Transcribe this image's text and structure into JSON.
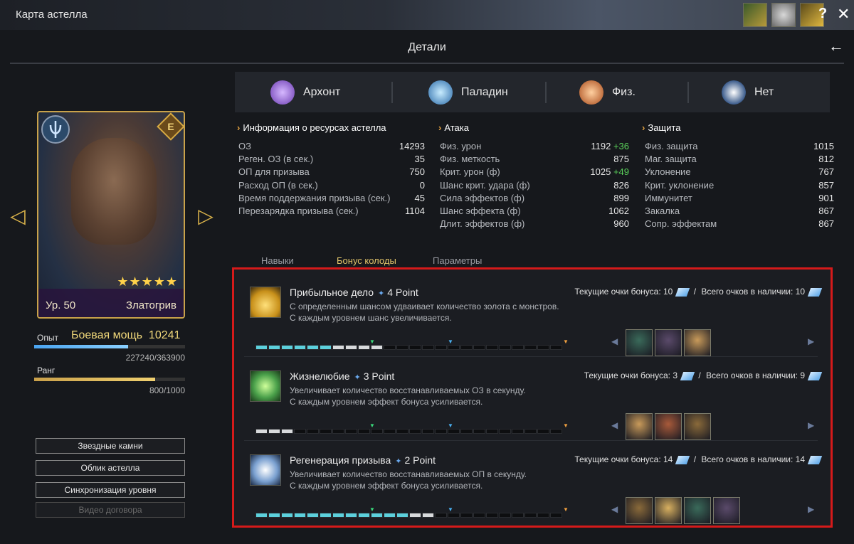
{
  "window": {
    "title": "Карта астелла",
    "help": "?",
    "close": "✕"
  },
  "header": {
    "title": "Детали",
    "back": "←"
  },
  "card": {
    "rank_badge": "E",
    "stars": "★★★★★",
    "level": "Ур. 50",
    "name": "Златогрив"
  },
  "progress": {
    "exp_label": "Опыт",
    "power_label": "Боевая мощь",
    "power_value": "10241",
    "exp_text": "227240/363900",
    "exp_fraction": 0.624,
    "rank_label": "Ранг",
    "rank_text": "800/1000",
    "rank_fraction": 0.8
  },
  "side_buttons": [
    {
      "label": "Звездные камни",
      "enabled": true
    },
    {
      "label": "Облик астелла",
      "enabled": true
    },
    {
      "label": "Синхронизация уровня",
      "enabled": true
    },
    {
      "label": "Видео договора",
      "enabled": false
    }
  ],
  "tags": [
    {
      "label": "Архонт",
      "icon": "archon-icon",
      "color": "#a07ad0"
    },
    {
      "label": "Паладин",
      "icon": "paladin-icon",
      "color": "#4aa4d8"
    },
    {
      "label": "Физ.",
      "icon": "physical-icon",
      "color": "#d87a3a"
    },
    {
      "label": "Нет",
      "icon": "element-none-icon",
      "color": "#8ab0e0"
    }
  ],
  "stats": {
    "resources": {
      "title": "Информация о ресурсах астелла",
      "rows": [
        {
          "label": "ОЗ",
          "value": "14293"
        },
        {
          "label": "Реген. ОЗ (в сек.)",
          "value": "35"
        },
        {
          "label": "ОП для призыва",
          "value": "750"
        },
        {
          "label": "Расход ОП (в сек.)",
          "value": "0"
        },
        {
          "label": "Время поддержания призыва (сек.)",
          "value": "45"
        },
        {
          "label": "Перезарядка призыва (сек.)",
          "value": "1104"
        }
      ]
    },
    "attack": {
      "title": "Атака",
      "rows": [
        {
          "label": "Физ. урон",
          "value": "1192",
          "bonus": "+36"
        },
        {
          "label": "Физ. меткость",
          "value": "875",
          "bonus": ""
        },
        {
          "label": "Крит. урон (ф)",
          "value": "1025",
          "bonus": "+49"
        },
        {
          "label": "Шанс крит. удара (ф)",
          "value": "826",
          "bonus": ""
        },
        {
          "label": "Сила эффектов (ф)",
          "value": "899",
          "bonus": ""
        },
        {
          "label": "Шанс эффекта (ф)",
          "value": "1062",
          "bonus": ""
        },
        {
          "label": "Длит. эффектов (ф)",
          "value": "960",
          "bonus": ""
        }
      ]
    },
    "defense": {
      "title": "Защита",
      "rows": [
        {
          "label": "Физ. защита",
          "value": "1015"
        },
        {
          "label": "Маг. защита",
          "value": "812"
        },
        {
          "label": "Уклонение",
          "value": "767"
        },
        {
          "label": "Крит. уклонение",
          "value": "857"
        },
        {
          "label": "Иммунитет",
          "value": "901"
        },
        {
          "label": "Закалка",
          "value": "867"
        },
        {
          "label": "Сопр. эффектам",
          "value": "867"
        }
      ]
    }
  },
  "tabs": [
    {
      "label": "Навыки",
      "active": false
    },
    {
      "label": "Бонус колоды",
      "active": true
    },
    {
      "label": "Параметры",
      "active": false
    }
  ],
  "bonuses": [
    {
      "name": "Прибыльное дело",
      "points": "4 Point",
      "desc1": "С определенным шансом удваивает количество золота с монстров.",
      "desc2": "С каждым уровнем шанс увеличивается.",
      "current": "Текущие очки бонуса: 10",
      "sep": "/",
      "total": "Всего очков в наличии: 10",
      "icon": "gold-bars-icon",
      "filled": 6,
      "partial": 4,
      "heroes": 3
    },
    {
      "name": "Жизнелюбие",
      "points": "3 Point",
      "desc1": "Увеличивает количество восстанавливаемых ОЗ в секунду.",
      "desc2": "С каждым уровнем эффект бонуса усиливается.",
      "current": "Текущие очки бонуса: 3",
      "sep": "/",
      "total": "Всего очков в наличии: 9",
      "icon": "green-cross-icon",
      "filled": 0,
      "partial": 3,
      "heroes": 3
    },
    {
      "name": "Регенерация призыва",
      "points": "2 Point",
      "desc1": "Увеличивает количество восстанавливаемых ОП в секунду.",
      "desc2": "С каждым уровнем эффект бонуса усиливается.",
      "current": "Текущие очки бонуса: 14",
      "sep": "/",
      "total": "Всего очков в наличии: 14",
      "icon": "blue-cross-icon",
      "filled": 12,
      "partial": 2,
      "heroes": 4
    }
  ]
}
